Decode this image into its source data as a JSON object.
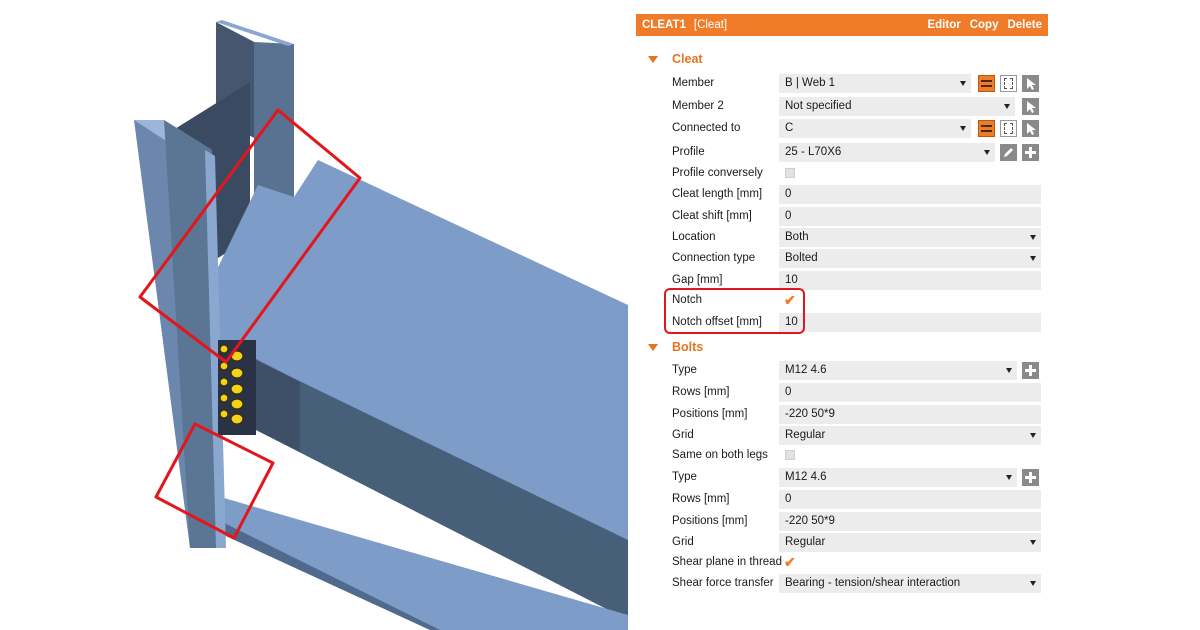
{
  "header": {
    "title": "CLEAT1",
    "subtitle": "[Cleat]",
    "actions": [
      "Editor",
      "Copy",
      "Delete"
    ]
  },
  "sections": {
    "cleat": "Cleat",
    "bolts": "Bolts"
  },
  "cleat_rows": [
    {
      "label": "Member",
      "value": "B | Web 1",
      "type": "dropdown"
    },
    {
      "label": "Member 2",
      "value": "Not specified",
      "type": "dropdown"
    },
    {
      "label": "Connected to",
      "value": "C",
      "type": "dropdown"
    },
    {
      "label": "Profile",
      "value": "25 - L70X6",
      "type": "dropdown"
    },
    {
      "label": "Profile conversely",
      "value": "",
      "type": "checkbox",
      "checked": false
    },
    {
      "label": "Cleat length [mm]",
      "value": "0",
      "type": "text"
    },
    {
      "label": "Cleat shift [mm]",
      "value": "0",
      "type": "text"
    },
    {
      "label": "Location",
      "value": "Both",
      "type": "dropdown"
    },
    {
      "label": "Connection type",
      "value": "Bolted",
      "type": "dropdown"
    },
    {
      "label": "Gap [mm]",
      "value": "10",
      "type": "text"
    },
    {
      "label": "Notch",
      "value": "",
      "type": "checkbox",
      "checked": true
    },
    {
      "label": "Notch offset [mm]",
      "value": "10",
      "type": "text"
    }
  ],
  "bolt_rows": [
    {
      "label": "Type",
      "value": "M12 4.6",
      "type": "dropdown"
    },
    {
      "label": "Rows [mm]",
      "value": "0",
      "type": "text"
    },
    {
      "label": "Positions [mm]",
      "value": "-220 50*9",
      "type": "text"
    },
    {
      "label": "Grid",
      "value": "Regular",
      "type": "dropdown"
    },
    {
      "label": "Same on both legs",
      "value": "",
      "type": "checkbox",
      "checked": false
    },
    {
      "label": "Type",
      "value": "M12 4.6",
      "type": "dropdown"
    },
    {
      "label": "Rows [mm]",
      "value": "0",
      "type": "text"
    },
    {
      "label": "Positions [mm]",
      "value": "-220 50*9",
      "type": "text"
    },
    {
      "label": "Grid",
      "value": "Regular",
      "type": "dropdown"
    },
    {
      "label": "Shear plane in thread",
      "value": "",
      "type": "checkbox",
      "checked": true
    },
    {
      "label": "Shear force transfer",
      "value": "Bearing - tension/shear interaction",
      "type": "dropdown"
    }
  ],
  "colors": {
    "accent": "#f07c2a",
    "highlight": "#e2161b",
    "steel_light": "#7d9cc8",
    "steel_dark": "#485f79",
    "bolt": "#f2d21b"
  }
}
